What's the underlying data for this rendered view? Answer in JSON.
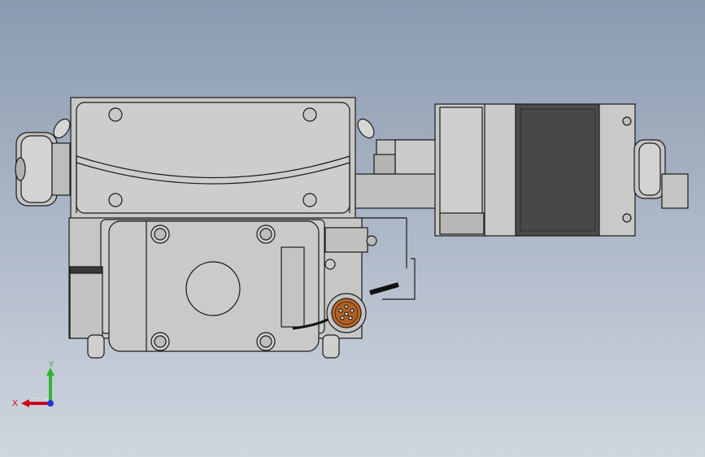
{
  "view": {
    "background_top": "#8b9ab0",
    "background_bottom": "#cfd6df"
  },
  "triad": {
    "x_label": "X",
    "y_label": "Y",
    "x_color": "#d0021b",
    "y_color": "#2fb52f",
    "z_color": "#2233dd"
  },
  "model": {
    "body_color": "#c9c9c7",
    "edge_color": "#1a1a1a",
    "motor_core_color": "#4a4c4a",
    "connector_color": "#c06a2b"
  }
}
